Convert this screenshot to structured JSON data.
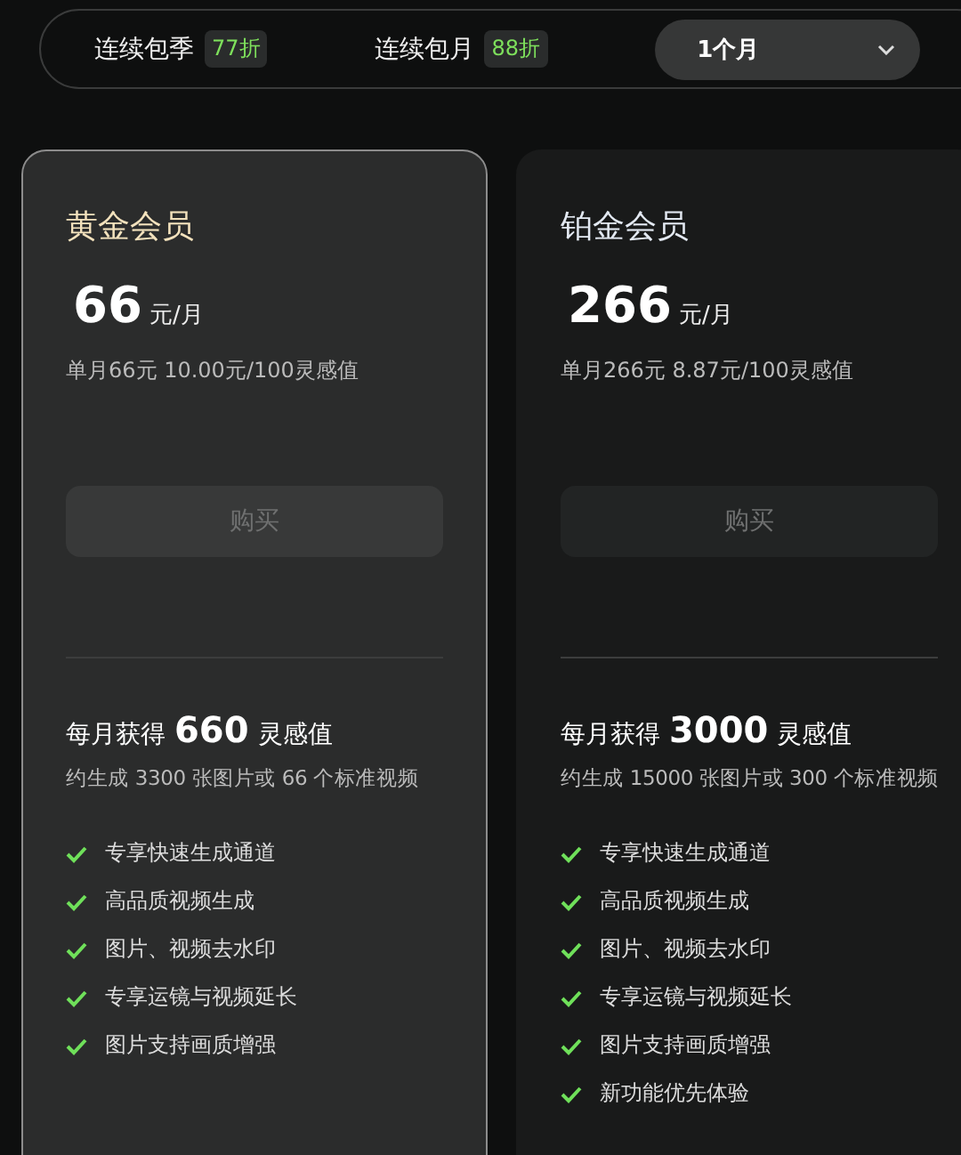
{
  "billing_tabs": [
    {
      "label": "连续包季",
      "discount": "77折"
    },
    {
      "label": "连续包月",
      "discount": "88折"
    }
  ],
  "period_select": {
    "value": "1个月"
  },
  "plans": [
    {
      "name": "黄金会员",
      "color": "#f3e2bd",
      "selected": true,
      "price": "66",
      "unit": "元/月",
      "detail": "单月66元 10.00元/100灵感值",
      "button": "购买",
      "credits_prefix": "每月获得",
      "credits": "660",
      "credits_suffix": "灵感值",
      "estimate": "约生成 3300 张图片或 66 个标准视频",
      "features": [
        "专享快速生成通道",
        "高品质视频生成",
        "图片、视频去水印",
        "专享运镜与视频延长",
        "图片支持画质增强"
      ]
    },
    {
      "name": "铂金会员",
      "color": "#e3e9f2",
      "selected": false,
      "price": "266",
      "unit": "元/月",
      "detail": "单月266元 8.87元/100灵感值",
      "button": "购买",
      "credits_prefix": "每月获得",
      "credits": "3000",
      "credits_suffix": "灵感值",
      "estimate": "约生成 15000 张图片或 300 个标准视频",
      "features": [
        "专享快速生成通道",
        "高品质视频生成",
        "图片、视频去水印",
        "专享运镜与视频延长",
        "图片支持画质增强",
        "新功能优先体验"
      ]
    }
  ]
}
